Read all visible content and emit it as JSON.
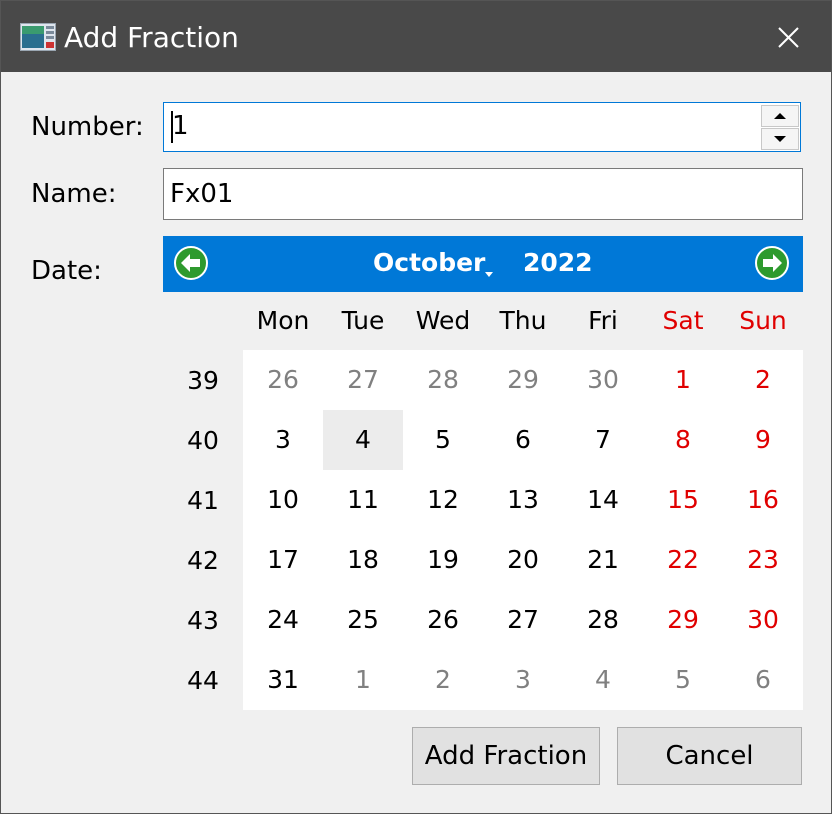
{
  "window": {
    "title": "Add Fraction",
    "icon": "app-window-icon",
    "close_icon": "close-icon"
  },
  "form": {
    "number_label": "Number:",
    "number_value": "1",
    "name_label": "Name:",
    "name_value": "Fx01",
    "date_label": "Date:"
  },
  "calendar": {
    "month": "October",
    "year": "2022",
    "prev_icon": "arrow-left-icon",
    "next_icon": "arrow-right-icon",
    "weekdays": [
      "Mon",
      "Tue",
      "Wed",
      "Thu",
      "Fri",
      "Sat",
      "Sun"
    ],
    "weeks": [
      {
        "num": "39",
        "days": [
          {
            "d": "26",
            "other": true
          },
          {
            "d": "27",
            "other": true
          },
          {
            "d": "28",
            "other": true
          },
          {
            "d": "29",
            "other": true
          },
          {
            "d": "30",
            "other": true
          },
          {
            "d": "1"
          },
          {
            "d": "2"
          }
        ]
      },
      {
        "num": "40",
        "days": [
          {
            "d": "3"
          },
          {
            "d": "4",
            "selected": true
          },
          {
            "d": "5"
          },
          {
            "d": "6"
          },
          {
            "d": "7"
          },
          {
            "d": "8"
          },
          {
            "d": "9"
          }
        ]
      },
      {
        "num": "41",
        "days": [
          {
            "d": "10"
          },
          {
            "d": "11"
          },
          {
            "d": "12"
          },
          {
            "d": "13"
          },
          {
            "d": "14"
          },
          {
            "d": "15"
          },
          {
            "d": "16"
          }
        ]
      },
      {
        "num": "42",
        "days": [
          {
            "d": "17"
          },
          {
            "d": "18"
          },
          {
            "d": "19"
          },
          {
            "d": "20"
          },
          {
            "d": "21"
          },
          {
            "d": "22"
          },
          {
            "d": "23"
          }
        ]
      },
      {
        "num": "43",
        "days": [
          {
            "d": "24"
          },
          {
            "d": "25"
          },
          {
            "d": "26"
          },
          {
            "d": "27"
          },
          {
            "d": "28"
          },
          {
            "d": "29"
          },
          {
            "d": "30"
          }
        ]
      },
      {
        "num": "44",
        "days": [
          {
            "d": "31"
          },
          {
            "d": "1",
            "other": true
          },
          {
            "d": "2",
            "other": true
          },
          {
            "d": "3",
            "other": true
          },
          {
            "d": "4",
            "other": true
          },
          {
            "d": "5",
            "other": true
          },
          {
            "d": "6",
            "other": true
          }
        ]
      }
    ],
    "colors": {
      "header_bg": "#0078d7",
      "weekend": "#e00000",
      "other_month": "#808080",
      "nav_button": "#2e9a2e"
    }
  },
  "buttons": {
    "add_label": "Add Fraction",
    "cancel_label": "Cancel"
  }
}
